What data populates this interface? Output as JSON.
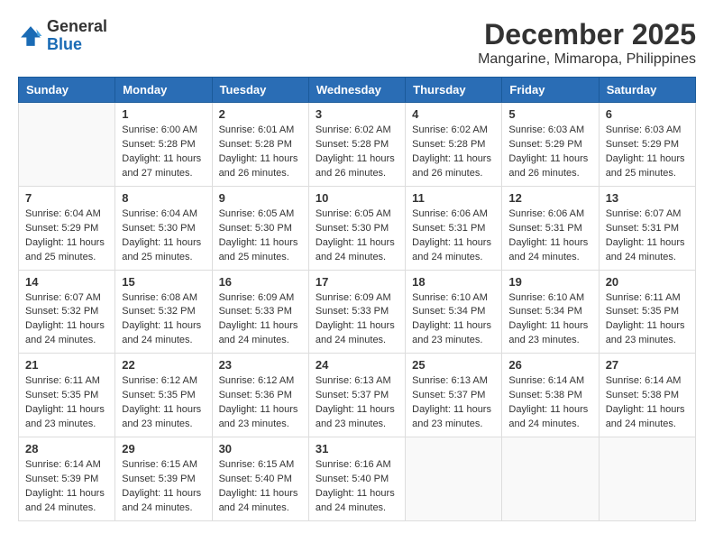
{
  "logo": {
    "line1": "General",
    "line2": "Blue"
  },
  "title": "December 2025",
  "location": "Mangarine, Mimaropa, Philippines",
  "weekdays": [
    "Sunday",
    "Monday",
    "Tuesday",
    "Wednesday",
    "Thursday",
    "Friday",
    "Saturday"
  ],
  "weeks": [
    [
      {
        "day": "",
        "sunrise": "",
        "sunset": "",
        "daylight": ""
      },
      {
        "day": "1",
        "sunrise": "Sunrise: 6:00 AM",
        "sunset": "Sunset: 5:28 PM",
        "daylight": "Daylight: 11 hours and 27 minutes."
      },
      {
        "day": "2",
        "sunrise": "Sunrise: 6:01 AM",
        "sunset": "Sunset: 5:28 PM",
        "daylight": "Daylight: 11 hours and 26 minutes."
      },
      {
        "day": "3",
        "sunrise": "Sunrise: 6:02 AM",
        "sunset": "Sunset: 5:28 PM",
        "daylight": "Daylight: 11 hours and 26 minutes."
      },
      {
        "day": "4",
        "sunrise": "Sunrise: 6:02 AM",
        "sunset": "Sunset: 5:28 PM",
        "daylight": "Daylight: 11 hours and 26 minutes."
      },
      {
        "day": "5",
        "sunrise": "Sunrise: 6:03 AM",
        "sunset": "Sunset: 5:29 PM",
        "daylight": "Daylight: 11 hours and 26 minutes."
      },
      {
        "day": "6",
        "sunrise": "Sunrise: 6:03 AM",
        "sunset": "Sunset: 5:29 PM",
        "daylight": "Daylight: 11 hours and 25 minutes."
      }
    ],
    [
      {
        "day": "7",
        "sunrise": "Sunrise: 6:04 AM",
        "sunset": "Sunset: 5:29 PM",
        "daylight": "Daylight: 11 hours and 25 minutes."
      },
      {
        "day": "8",
        "sunrise": "Sunrise: 6:04 AM",
        "sunset": "Sunset: 5:30 PM",
        "daylight": "Daylight: 11 hours and 25 minutes."
      },
      {
        "day": "9",
        "sunrise": "Sunrise: 6:05 AM",
        "sunset": "Sunset: 5:30 PM",
        "daylight": "Daylight: 11 hours and 25 minutes."
      },
      {
        "day": "10",
        "sunrise": "Sunrise: 6:05 AM",
        "sunset": "Sunset: 5:30 PM",
        "daylight": "Daylight: 11 hours and 24 minutes."
      },
      {
        "day": "11",
        "sunrise": "Sunrise: 6:06 AM",
        "sunset": "Sunset: 5:31 PM",
        "daylight": "Daylight: 11 hours and 24 minutes."
      },
      {
        "day": "12",
        "sunrise": "Sunrise: 6:06 AM",
        "sunset": "Sunset: 5:31 PM",
        "daylight": "Daylight: 11 hours and 24 minutes."
      },
      {
        "day": "13",
        "sunrise": "Sunrise: 6:07 AM",
        "sunset": "Sunset: 5:31 PM",
        "daylight": "Daylight: 11 hours and 24 minutes."
      }
    ],
    [
      {
        "day": "14",
        "sunrise": "Sunrise: 6:07 AM",
        "sunset": "Sunset: 5:32 PM",
        "daylight": "Daylight: 11 hours and 24 minutes."
      },
      {
        "day": "15",
        "sunrise": "Sunrise: 6:08 AM",
        "sunset": "Sunset: 5:32 PM",
        "daylight": "Daylight: 11 hours and 24 minutes."
      },
      {
        "day": "16",
        "sunrise": "Sunrise: 6:09 AM",
        "sunset": "Sunset: 5:33 PM",
        "daylight": "Daylight: 11 hours and 24 minutes."
      },
      {
        "day": "17",
        "sunrise": "Sunrise: 6:09 AM",
        "sunset": "Sunset: 5:33 PM",
        "daylight": "Daylight: 11 hours and 24 minutes."
      },
      {
        "day": "18",
        "sunrise": "Sunrise: 6:10 AM",
        "sunset": "Sunset: 5:34 PM",
        "daylight": "Daylight: 11 hours and 23 minutes."
      },
      {
        "day": "19",
        "sunrise": "Sunrise: 6:10 AM",
        "sunset": "Sunset: 5:34 PM",
        "daylight": "Daylight: 11 hours and 23 minutes."
      },
      {
        "day": "20",
        "sunrise": "Sunrise: 6:11 AM",
        "sunset": "Sunset: 5:35 PM",
        "daylight": "Daylight: 11 hours and 23 minutes."
      }
    ],
    [
      {
        "day": "21",
        "sunrise": "Sunrise: 6:11 AM",
        "sunset": "Sunset: 5:35 PM",
        "daylight": "Daylight: 11 hours and 23 minutes."
      },
      {
        "day": "22",
        "sunrise": "Sunrise: 6:12 AM",
        "sunset": "Sunset: 5:35 PM",
        "daylight": "Daylight: 11 hours and 23 minutes."
      },
      {
        "day": "23",
        "sunrise": "Sunrise: 6:12 AM",
        "sunset": "Sunset: 5:36 PM",
        "daylight": "Daylight: 11 hours and 23 minutes."
      },
      {
        "day": "24",
        "sunrise": "Sunrise: 6:13 AM",
        "sunset": "Sunset: 5:37 PM",
        "daylight": "Daylight: 11 hours and 23 minutes."
      },
      {
        "day": "25",
        "sunrise": "Sunrise: 6:13 AM",
        "sunset": "Sunset: 5:37 PM",
        "daylight": "Daylight: 11 hours and 23 minutes."
      },
      {
        "day": "26",
        "sunrise": "Sunrise: 6:14 AM",
        "sunset": "Sunset: 5:38 PM",
        "daylight": "Daylight: 11 hours and 24 minutes."
      },
      {
        "day": "27",
        "sunrise": "Sunrise: 6:14 AM",
        "sunset": "Sunset: 5:38 PM",
        "daylight": "Daylight: 11 hours and 24 minutes."
      }
    ],
    [
      {
        "day": "28",
        "sunrise": "Sunrise: 6:14 AM",
        "sunset": "Sunset: 5:39 PM",
        "daylight": "Daylight: 11 hours and 24 minutes."
      },
      {
        "day": "29",
        "sunrise": "Sunrise: 6:15 AM",
        "sunset": "Sunset: 5:39 PM",
        "daylight": "Daylight: 11 hours and 24 minutes."
      },
      {
        "day": "30",
        "sunrise": "Sunrise: 6:15 AM",
        "sunset": "Sunset: 5:40 PM",
        "daylight": "Daylight: 11 hours and 24 minutes."
      },
      {
        "day": "31",
        "sunrise": "Sunrise: 6:16 AM",
        "sunset": "Sunset: 5:40 PM",
        "daylight": "Daylight: 11 hours and 24 minutes."
      },
      {
        "day": "",
        "sunrise": "",
        "sunset": "",
        "daylight": ""
      },
      {
        "day": "",
        "sunrise": "",
        "sunset": "",
        "daylight": ""
      },
      {
        "day": "",
        "sunrise": "",
        "sunset": "",
        "daylight": ""
      }
    ]
  ]
}
